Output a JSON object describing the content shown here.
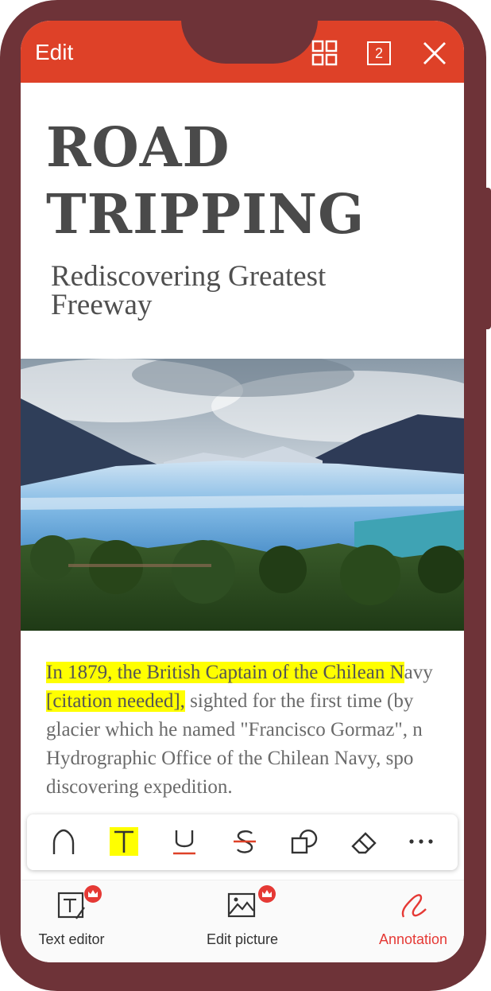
{
  "topbar": {
    "title": "Edit",
    "page_count": "2",
    "icons": [
      "grid-icon",
      "pages-icon",
      "close-icon"
    ]
  },
  "document": {
    "title_line1": "ROAD",
    "title_line2": "TRIPPING",
    "subtitle_line1": "Rediscovering Greatest",
    "subtitle_line2": "Freeway",
    "paragraph": {
      "line1_highlight": "In 1879, the British Captain of the Chilean N",
      "line1_rest": "avy",
      "line2_highlight": "[citation needed],",
      "line2_rest": " sighted for the first time (by",
      "line3": "glacier which he named \"Francisco Gormaz\", n",
      "line4": "Hydrographic Office of the Chilean Navy, spo",
      "line5": "discovering expedition."
    }
  },
  "annotation_toolbar": {
    "tools": [
      "pen-icon",
      "highlight-text-icon",
      "underline-icon",
      "strikethrough-icon",
      "shapes-icon",
      "eraser-icon",
      "more-icon"
    ],
    "highlight_color": "#ffff00",
    "accent_color": "#de4128"
  },
  "bottom_nav": {
    "items": [
      {
        "label": "Text editor",
        "icon": "text-editor-icon",
        "premium": true
      },
      {
        "label": "Edit picture",
        "icon": "edit-picture-icon",
        "premium": true
      },
      {
        "label": "Annotation",
        "icon": "annotation-icon",
        "active": true
      }
    ]
  },
  "colors": {
    "frame": "#6e3338",
    "topbar": "#de4128",
    "active": "#e53935"
  }
}
